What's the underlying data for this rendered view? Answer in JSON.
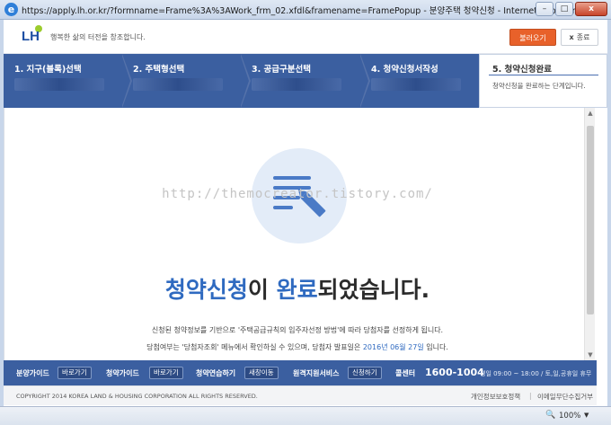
{
  "window": {
    "icon": "e",
    "title": "https://apply.lh.or.kr/?formname=Frame%3A%3AWork_frm_02.xfdl&framename=FramePopup - 분양주택 청약신청 - Internet Explorer",
    "minimize": "–",
    "maximize": "□",
    "close": "x"
  },
  "header": {
    "logo": "LH",
    "slogan": "행복한 삶의 터전을 창조합니다.",
    "load_button": "불러오기",
    "close_button_icon": "x",
    "close_button": "종료"
  },
  "steps": [
    {
      "label": "1. 지구(블록)선택"
    },
    {
      "label": "2. 주택형선택"
    },
    {
      "label": "3. 공급구분선택"
    },
    {
      "label": "4. 청약신청서작성"
    },
    {
      "label": "5. 청약신청완료",
      "desc": "청약신청을 완료하는 단계입니다."
    }
  ],
  "content": {
    "watermark": "http://themocreator.tistory.com/",
    "title_hl1": "청약신청",
    "title_mid": "이 ",
    "title_hl2": "완료",
    "title_end": "되었습니다.",
    "line1": "신청된 청약정보를 기반으로 '주택공급규칙의 입주자선정 방법'에 따라 당첨자를 선정하게 됩니다.",
    "line2_pre": "당첨여부는 '당첨자조회' 메뉴에서 확인하실 수 있으며, 당첨자 발표일은 ",
    "line2_date": "2016년 06월 27일",
    "line2_post": " 입니다."
  },
  "footer_nav": {
    "guide1": "분양가이드",
    "guide1_tag": "바로가기",
    "guide2": "청약가이드",
    "guide2_tag": "바로가기",
    "practice": "청약연습하기",
    "practice_tag": "새창이동",
    "remote": "원격지원서비스",
    "remote_tag": "신청하기",
    "call_label": "콜센터",
    "phone": "1600-1004",
    "hours": "평일 09:00 ~ 18:00 / 토,일,공휴일 휴무"
  },
  "copyright": {
    "text": "COPYRIGHT 2014 KOREA LAND & HOUSING CORPORATION ALL RIGHTS RESERVED.",
    "privacy": "개인정보보호정책",
    "email": "이메일무단수집거부"
  },
  "statusbar": {
    "zoom": "100%",
    "zoom_icon": "zoom-icon"
  },
  "colors": {
    "primary": "#3b5fa0",
    "accent": "#e8612a",
    "highlight": "#2f6ac0"
  }
}
